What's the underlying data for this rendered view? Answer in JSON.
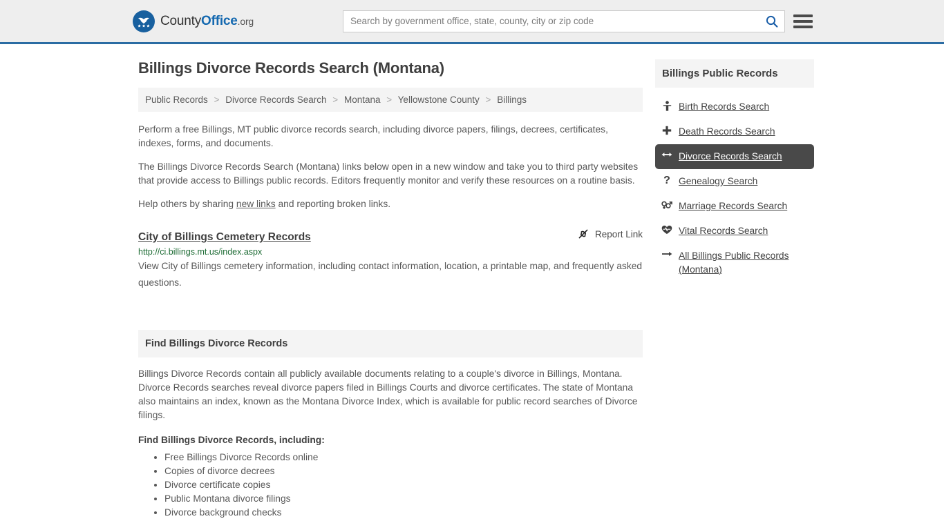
{
  "header": {
    "brand_county": "County",
    "brand_office": "Office",
    "brand_org": ".org",
    "logo_icon": "eagle-seal-logo",
    "search_placeholder": "Search by government office, state, county, city or zip code",
    "search_value": "",
    "search_icon": "search-icon",
    "menu_icon": "hamburger-menu-icon",
    "accent_color": "#2b6ca3",
    "background_color": "#eeeeee"
  },
  "main": {
    "title": "Billings Divorce Records Search (Montana)",
    "breadcrumb": [
      "Public Records",
      "Divorce Records Search",
      "Montana",
      "Yellowstone County",
      "Billings"
    ],
    "breadcrumb_separator": ">",
    "intro_paragraphs": [
      "Perform a free Billings, MT public divorce records search, including divorce papers, filings, decrees, certificates, indexes, forms, and documents.",
      "The Billings Divorce Records Search (Montana) links below open in a new window and take you to third party websites that provide access to Billings public records. Editors frequently monitor and verify these resources on a routine basis."
    ],
    "help_prefix": "Help others by sharing ",
    "help_link": "new links",
    "help_suffix": " and reporting broken links.",
    "results": [
      {
        "title": "City of Billings Cemetery Records",
        "report_label": "Report Link",
        "report_icon": "broken-link-icon",
        "url": "http://ci.billings.mt.us/index.aspx",
        "url_color": "#1d6b34",
        "description": "View City of Billings cemetery information, including contact information, location, a printable map, and frequently asked questions."
      }
    ],
    "section": {
      "heading": "Find Billings Divorce Records",
      "paragraph": "Billings Divorce Records contain all publicly available documents relating to a couple's divorce in Billings, Montana. Divorce Records searches reveal divorce papers filed in Billings Courts and divorce certificates. The state of Montana also maintains an index, known as the Montana Divorce Index, which is available for public record searches of Divorce filings.",
      "list_heading": "Find Billings Divorce Records, including:",
      "list_items": [
        "Free Billings Divorce Records online",
        "Copies of divorce decrees",
        "Divorce certificate copies",
        "Public Montana divorce filings",
        "Divorce background checks"
      ]
    }
  },
  "sidebar": {
    "heading": "Billings Public Records",
    "active_background": "#494949",
    "items": [
      {
        "label": "Birth Records Search",
        "icon": "baby-icon",
        "active": false
      },
      {
        "label": "Death Records Search",
        "icon": "cross-icon",
        "active": false
      },
      {
        "label": "Divorce Records Search",
        "icon": "left-right-arrow-icon",
        "active": true
      },
      {
        "label": "Genealogy Search",
        "icon": "question-mark-icon",
        "active": false
      },
      {
        "label": "Marriage Records Search",
        "icon": "venus-mars-icon",
        "active": false
      },
      {
        "label": "Vital Records Search",
        "icon": "heart-pulse-icon",
        "active": false
      },
      {
        "label": "All Billings Public Records (Montana)",
        "icon": "arrow-right-icon",
        "active": false
      }
    ]
  }
}
